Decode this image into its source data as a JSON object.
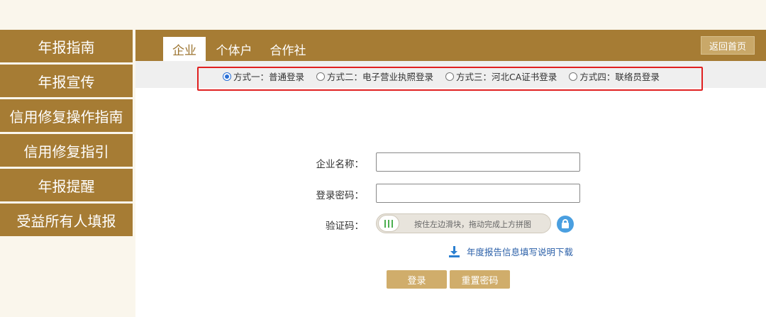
{
  "sidebar": {
    "items": [
      {
        "label": "年报指南"
      },
      {
        "label": "年报宣传"
      },
      {
        "label": "信用修复操作指南"
      },
      {
        "label": "信用修复指引"
      },
      {
        "label": "年报提醒"
      },
      {
        "label": "受益所有人填报"
      }
    ]
  },
  "tabs": {
    "enterprise": "企业",
    "individual": "个体户",
    "coop": "合作社",
    "back_home": "返回首页"
  },
  "methods": [
    {
      "label": "方式一：普通登录",
      "selected": true
    },
    {
      "label": "方式二：电子营业执照登录",
      "selected": false
    },
    {
      "label": "方式三：河北CA证书登录",
      "selected": false
    },
    {
      "label": "方式四：联络员登录",
      "selected": false
    }
  ],
  "form": {
    "company_label": "企业名称：",
    "company_value": "",
    "password_label": "登录密码：",
    "password_value": "",
    "captcha_label": "验证码：",
    "slider_text": "按住左边滑块，拖动完成上方拼图"
  },
  "download": {
    "label": "年度报告信息填写说明下载"
  },
  "buttons": {
    "login": "登录",
    "reset": "重置密码"
  },
  "colors": {
    "brand": "#a67c34",
    "button": "#d0ad6b",
    "highlight": "#e02020",
    "link": "#2a5fa8"
  }
}
